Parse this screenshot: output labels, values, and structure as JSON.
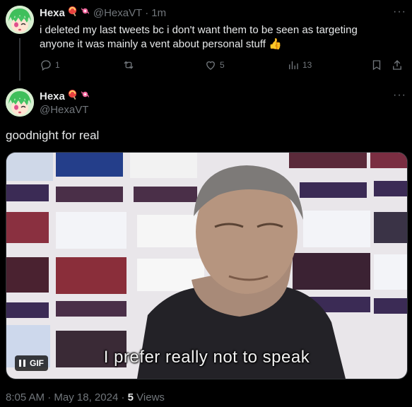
{
  "tweet1": {
    "display_name": "Hexa",
    "handle": "@HexaVT",
    "separator": "·",
    "time": "1m",
    "text": "i deleted my last tweets bc i don't want them to be seen as targeting anyone it was mainly a vent about personal stuff 👍",
    "actions": {
      "reply_count": "1",
      "retweet_count": "",
      "like_count": "5",
      "view_count": "13"
    },
    "icons": [
      "reply-icon",
      "retweet-icon",
      "heart-icon",
      "analytics-icon",
      "bookmark-icon",
      "share-icon",
      "more-icon"
    ]
  },
  "tweet2": {
    "display_name": "Hexa",
    "handle": "@HexaVT",
    "text": "goodnight for real",
    "media": {
      "caption": "I prefer really not to speak",
      "badge": "GIF"
    },
    "meta": {
      "time": "8:05 AM",
      "sep1": "·",
      "date": "May 18, 2024",
      "sep2": "·",
      "views_count": "5",
      "views_label": "Views"
    }
  },
  "colors": {
    "background": "#000000",
    "text": "#e7e9ea",
    "secondary": "#71767b"
  }
}
